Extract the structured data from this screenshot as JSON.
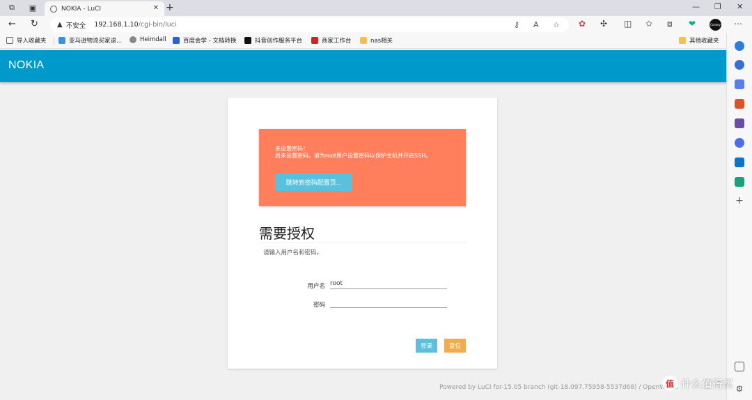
{
  "browser": {
    "tab_title": "NOKIA - LuCI",
    "address": {
      "security_label": "不安全",
      "host": "192.168.1.10",
      "path": "/cgi-bin/luci"
    },
    "bookmarks": [
      {
        "label": "导入收藏夹",
        "color": "#666666"
      },
      {
        "label": "亚马逊物流买家退...",
        "color": "#3d8fe0"
      },
      {
        "label": "Heimdall",
        "color": "#888888"
      },
      {
        "label": "百度会学 - 文档转换",
        "color": "#2d5fd8"
      },
      {
        "label": "抖音创作服务平台",
        "color": "#111111"
      },
      {
        "label": "商家工作台",
        "color": "#d22222"
      },
      {
        "label": "nas相关",
        "color": "#f2c14e"
      }
    ],
    "other_bookmarks": "其他收藏夹",
    "profile_label": "Cookey"
  },
  "page": {
    "brand": "NOKIA",
    "alert": {
      "line1": "未设置密码！",
      "line2": "尚未设置密码。请为root用户设置密码以保护主机并开启SSH。",
      "button": "跳转到密码配置页..."
    },
    "auth": {
      "title": "需要授权",
      "description": "请输入用户名和密码。",
      "username_label": "用户名",
      "username_value": "root",
      "password_label": "密码",
      "password_value": ""
    },
    "buttons": {
      "login": "登录",
      "reset": "复位"
    },
    "footer": "Powered by LuCI for-15.05 branch (git-18.097.75958-5537d68) / OpenWrt ..."
  },
  "watermark": "什么值得买",
  "colors": {
    "header": "#0099cc",
    "alert": "#ff7f5c",
    "login": "#5bc0de",
    "reset": "#f0ad4e"
  }
}
